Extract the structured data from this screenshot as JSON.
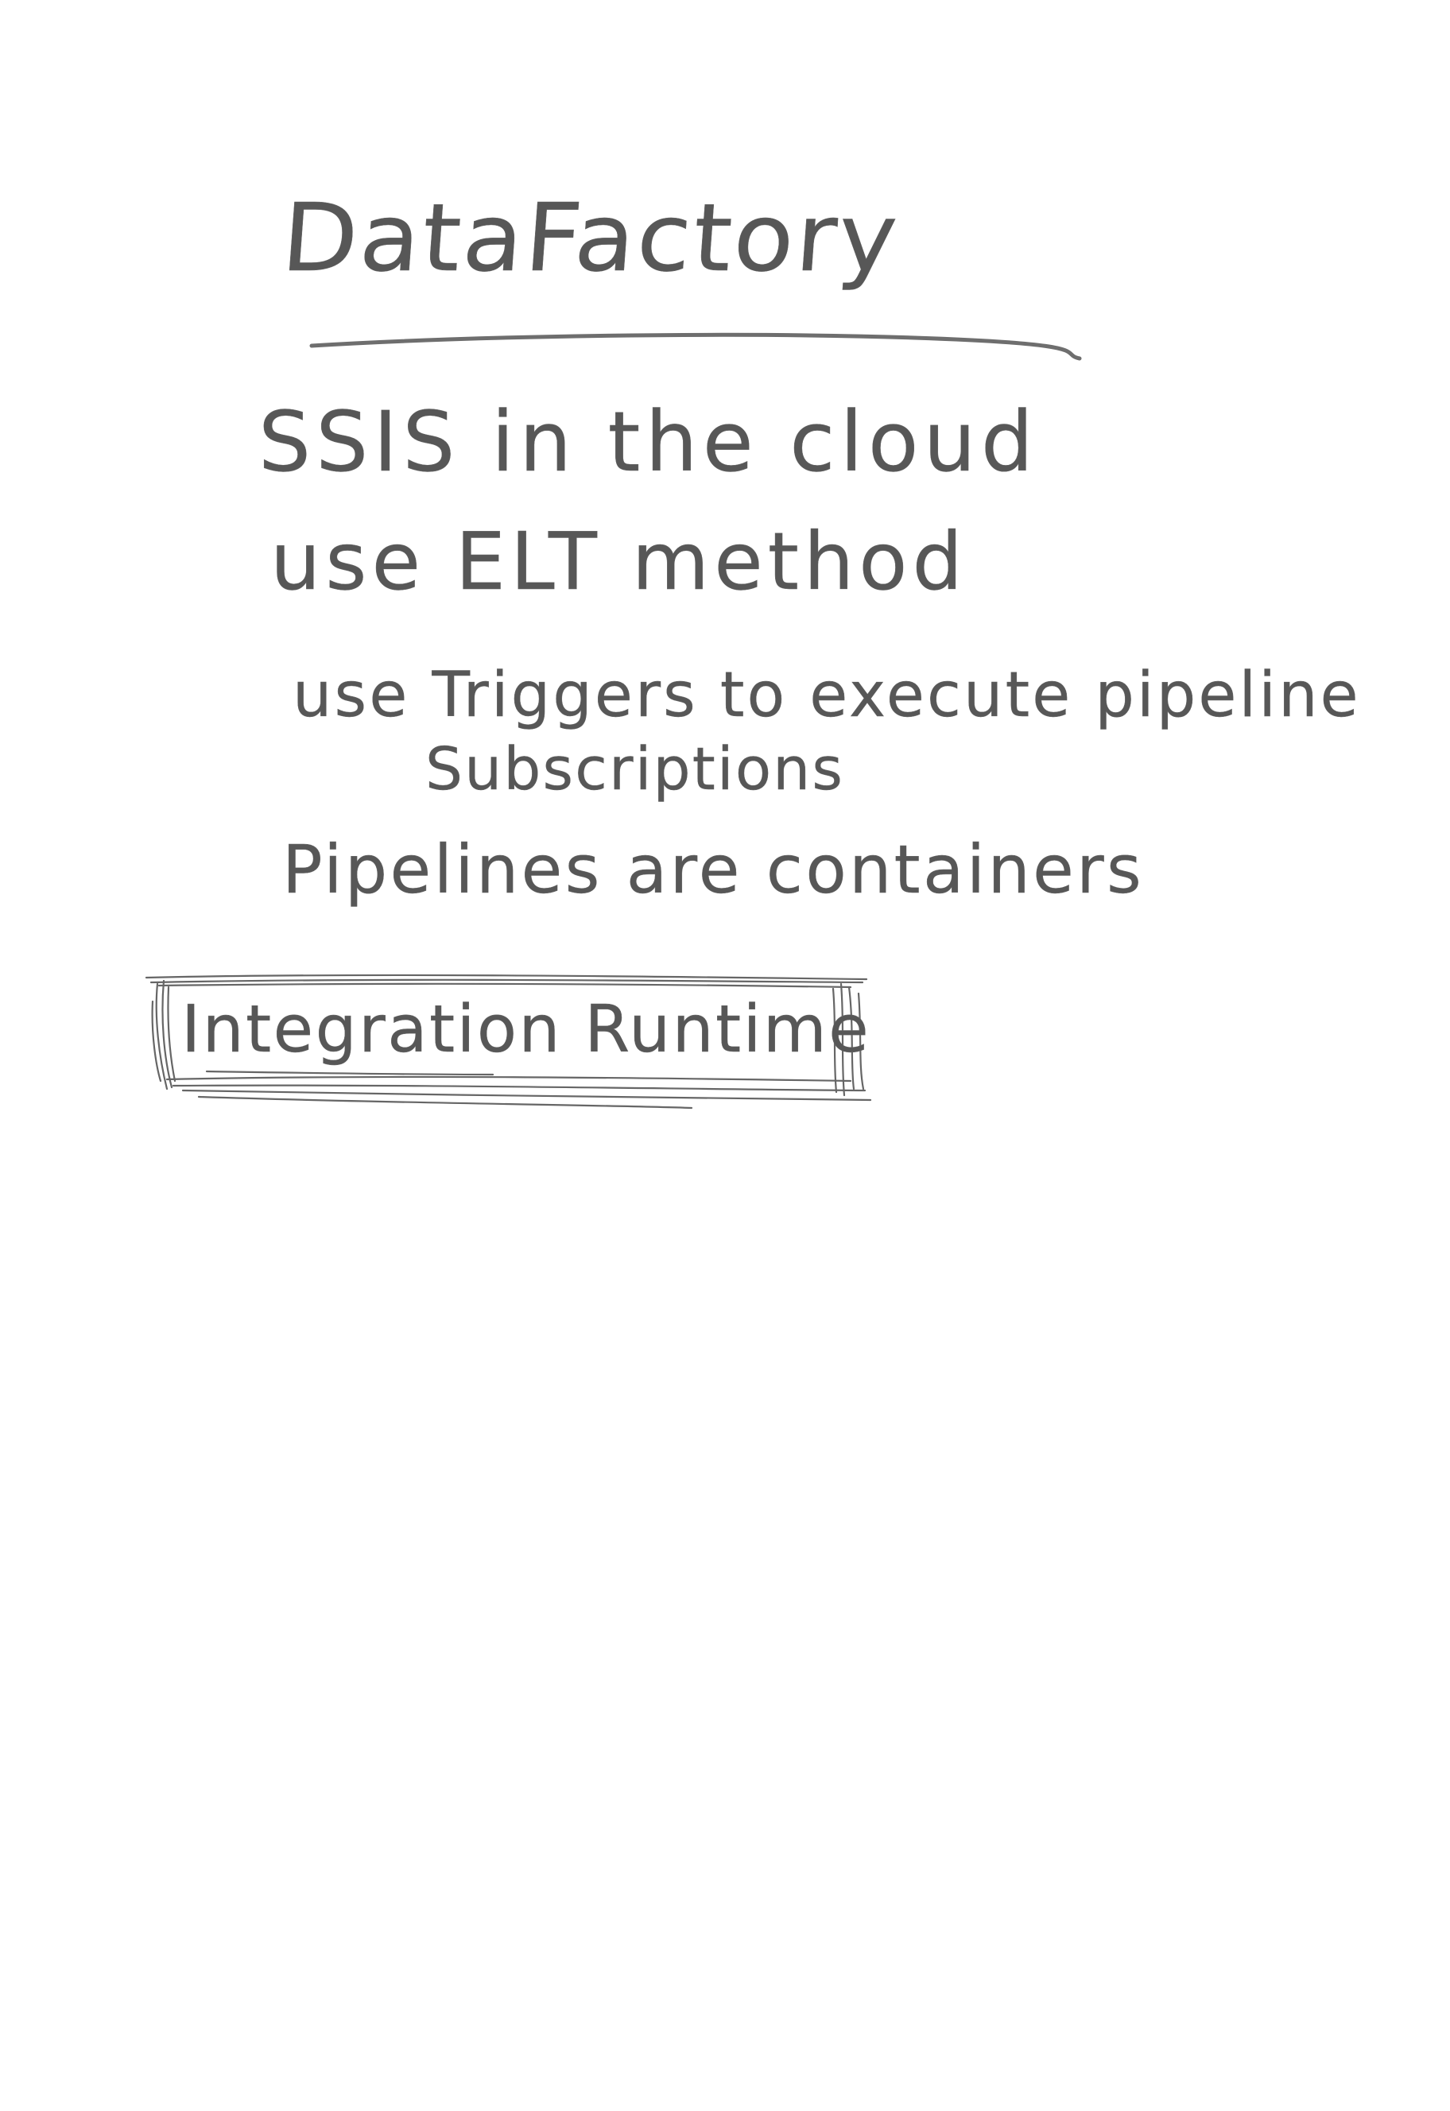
{
  "note": {
    "title": "DataFactory",
    "lines": [
      "SSIS in the cloud",
      "use ELT method",
      "use Triggers to execute pipeline",
      "Subscriptions",
      "Pipelines are containers"
    ],
    "boxed_label": "Integration Runtime"
  },
  "colors": {
    "ink": "#575757",
    "paper": "#ffffff"
  }
}
